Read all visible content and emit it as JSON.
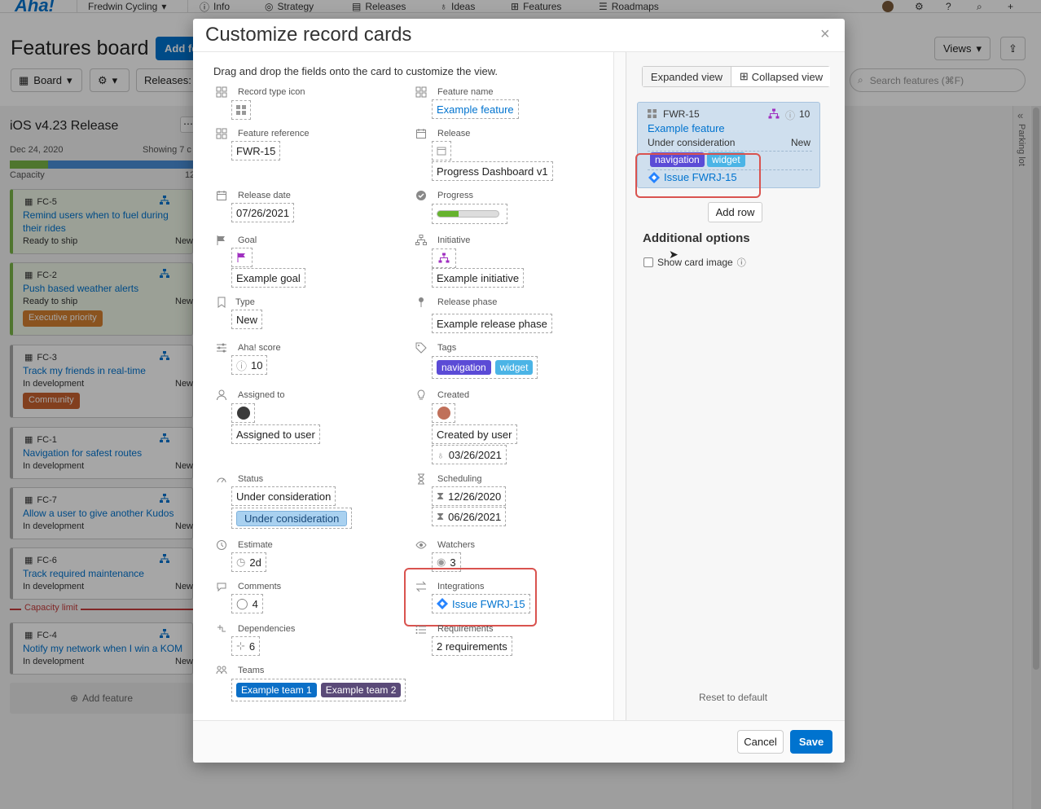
{
  "app": {
    "logo": "Aha!",
    "workspace": "Fredwin Cycling",
    "nav": [
      "Info",
      "Strategy",
      "Releases",
      "Ideas",
      "Features",
      "Roadmaps"
    ]
  },
  "page": {
    "title": "Features board",
    "add_feature": "Add fe",
    "views": "Views",
    "toolbar": {
      "board": "Board",
      "releases": "Releases: A"
    },
    "search_placeholder": "Search features (⌘F)",
    "parking_lot": "Parking lot"
  },
  "release": {
    "name": "iOS v4.23 Release",
    "date": "Dec 24, 2020",
    "showing": "Showing 7 c",
    "capacity": "Capacity",
    "capacity_right": "12",
    "capacity_limit": "Capacity limit",
    "add_feature": "Add feature"
  },
  "cards": [
    {
      "ref": "FC-5",
      "title": "Remind users when to fuel during their rides",
      "status": "Ready to ship",
      "type": "New",
      "tag": ""
    },
    {
      "ref": "FC-2",
      "title": "Push based weather alerts",
      "status": "Ready to ship",
      "type": "New",
      "tag": "Executive priority"
    },
    {
      "ref": "FC-3",
      "title": "Track my friends in real-time",
      "status": "In development",
      "type": "New",
      "tag": "Community"
    },
    {
      "ref": "FC-1",
      "title": "Navigation for safest routes",
      "status": "In development",
      "type": "New",
      "tag": ""
    },
    {
      "ref": "FC-7",
      "title": "Allow a user to give another Kudos",
      "status": "In development",
      "type": "New",
      "tag": ""
    },
    {
      "ref": "FC-6",
      "title": "Track required maintenance",
      "status": "In development",
      "type": "New",
      "tag": ""
    },
    {
      "ref": "FC-4",
      "title": "Notify my network when I win a KOM",
      "status": "In development",
      "type": "New",
      "tag": ""
    }
  ],
  "modal": {
    "title": "Customize record cards",
    "close": "×",
    "instructions": "Drag and drop the fields onto the card to customize the view.",
    "cancel": "Cancel",
    "save": "Save"
  },
  "fields": {
    "record_type_icon": {
      "label": "Record type icon"
    },
    "feature_name": {
      "label": "Feature name",
      "value": "Example feature"
    },
    "feature_reference": {
      "label": "Feature reference",
      "value": "FWR-15"
    },
    "release": {
      "label": "Release",
      "value": "Progress Dashboard v1"
    },
    "release_date": {
      "label": "Release date",
      "value": "07/26/2021"
    },
    "progress": {
      "label": "Progress",
      "fraction": 0.35
    },
    "goal": {
      "label": "Goal",
      "value": "Example goal"
    },
    "initiative": {
      "label": "Initiative",
      "value": "Example initiative"
    },
    "type": {
      "label": "Type",
      "value": "New"
    },
    "release_phase": {
      "label": "Release phase",
      "value": "Example release phase"
    },
    "aha_score": {
      "label": "Aha! score",
      "value": "10"
    },
    "tags": {
      "label": "Tags",
      "items": [
        "navigation",
        "widget"
      ]
    },
    "assigned_to": {
      "label": "Assigned to",
      "value": "Assigned to user"
    },
    "created": {
      "label": "Created",
      "value": "Created by user",
      "date": "03/26/2021"
    },
    "status": {
      "label": "Status",
      "value": "Under consideration",
      "badge": "Under consideration"
    },
    "scheduling": {
      "label": "Scheduling",
      "start": "12/26/2020",
      "end": "06/26/2021"
    },
    "estimate": {
      "label": "Estimate",
      "value": "2d"
    },
    "watchers": {
      "label": "Watchers",
      "value": "3"
    },
    "comments": {
      "label": "Comments",
      "value": "4"
    },
    "integrations": {
      "label": "Integrations",
      "value": "Issue FWRJ-15"
    },
    "dependencies": {
      "label": "Dependencies",
      "value": "6"
    },
    "requirements": {
      "label": "Requirements",
      "value": "2 requirements"
    },
    "teams": {
      "label": "Teams",
      "items": [
        "Example team 1",
        "Example team 2"
      ]
    }
  },
  "preview": {
    "tabs": [
      "Expanded view",
      "Collapsed view"
    ],
    "ref": "FWR-15",
    "score": "10",
    "name": "Example feature",
    "status": "Under consideration",
    "type": "New",
    "tags": [
      "navigation",
      "widget"
    ],
    "integration": "Issue FWRJ-15",
    "add_row": "Add row",
    "additional_options": "Additional options",
    "show_card_image": "Show card image",
    "reset": "Reset to default"
  },
  "colors": {
    "brand": "#0073cf",
    "tag_navigation": "#5b4bd6",
    "tag_widget": "#4bb4e6",
    "team1": "#0b6fc7",
    "team2": "#5a4a78",
    "highlight": "#d9534f",
    "progress": "#66b32e"
  }
}
